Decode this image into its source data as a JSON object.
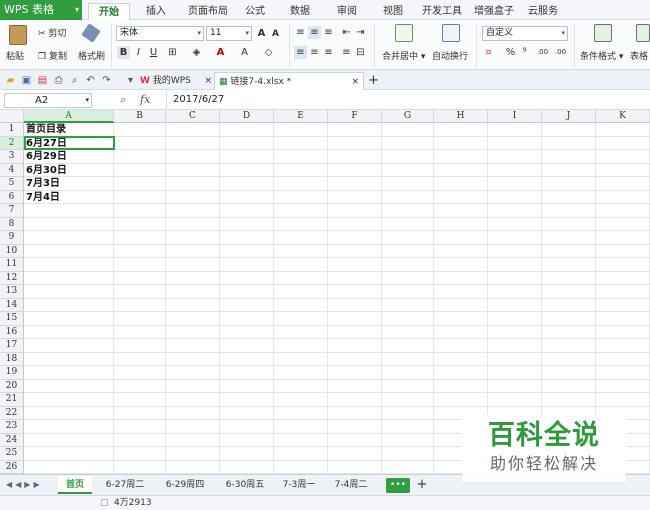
{
  "app": {
    "name": "WPS 表格"
  },
  "menu_tabs": [
    "开始",
    "插入",
    "页面布局",
    "公式",
    "数据",
    "审阅",
    "视图",
    "开发工具",
    "增强盒子",
    "云服务"
  ],
  "ribbon": {
    "paste": "粘贴",
    "cut": "剪切",
    "copy": "复制",
    "format_painter": "格式刷",
    "font_name": "宋体",
    "font_size": "11",
    "merge_center": "合并居中",
    "wrap_text": "自动换行",
    "number_format": "自定义",
    "percent": "%",
    "comma": "⁹",
    "inc_decimal": ".00",
    "dec_decimal": ".00",
    "conditional_format": "条件格式",
    "table_style": "表格"
  },
  "doc_tabs": [
    {
      "label": "我的WPS"
    },
    {
      "label": "链接7-4.xlsx *"
    }
  ],
  "formula": {
    "name_box": "A2",
    "fx": "fx",
    "value": "2017/6/27"
  },
  "columns": [
    "A",
    "B",
    "C",
    "D",
    "E",
    "F",
    "G",
    "H",
    "I",
    "J",
    "K"
  ],
  "rows": [
    "1",
    "2",
    "3",
    "4",
    "5",
    "6",
    "7",
    "8",
    "9",
    "10",
    "11",
    "12",
    "13",
    "14",
    "15",
    "16",
    "17",
    "18",
    "19",
    "20",
    "21",
    "22",
    "23",
    "24",
    "25",
    "26"
  ],
  "cells": [
    "首页目录",
    "6月27日",
    "6月29日",
    "6月30日",
    "7月3日",
    "7月4日"
  ],
  "sheets": [
    "首页",
    "6-27周二",
    "6-29周四",
    "6-30周五",
    "7-3周一",
    "7-4周二"
  ],
  "sheet_more": "•••",
  "sheet_add": "+",
  "status": {
    "count": "4万2913"
  },
  "watermark": {
    "title": "百科全说",
    "subtitle": "助你轻松解决"
  },
  "colors": {
    "accent": "#2f9e3f"
  }
}
